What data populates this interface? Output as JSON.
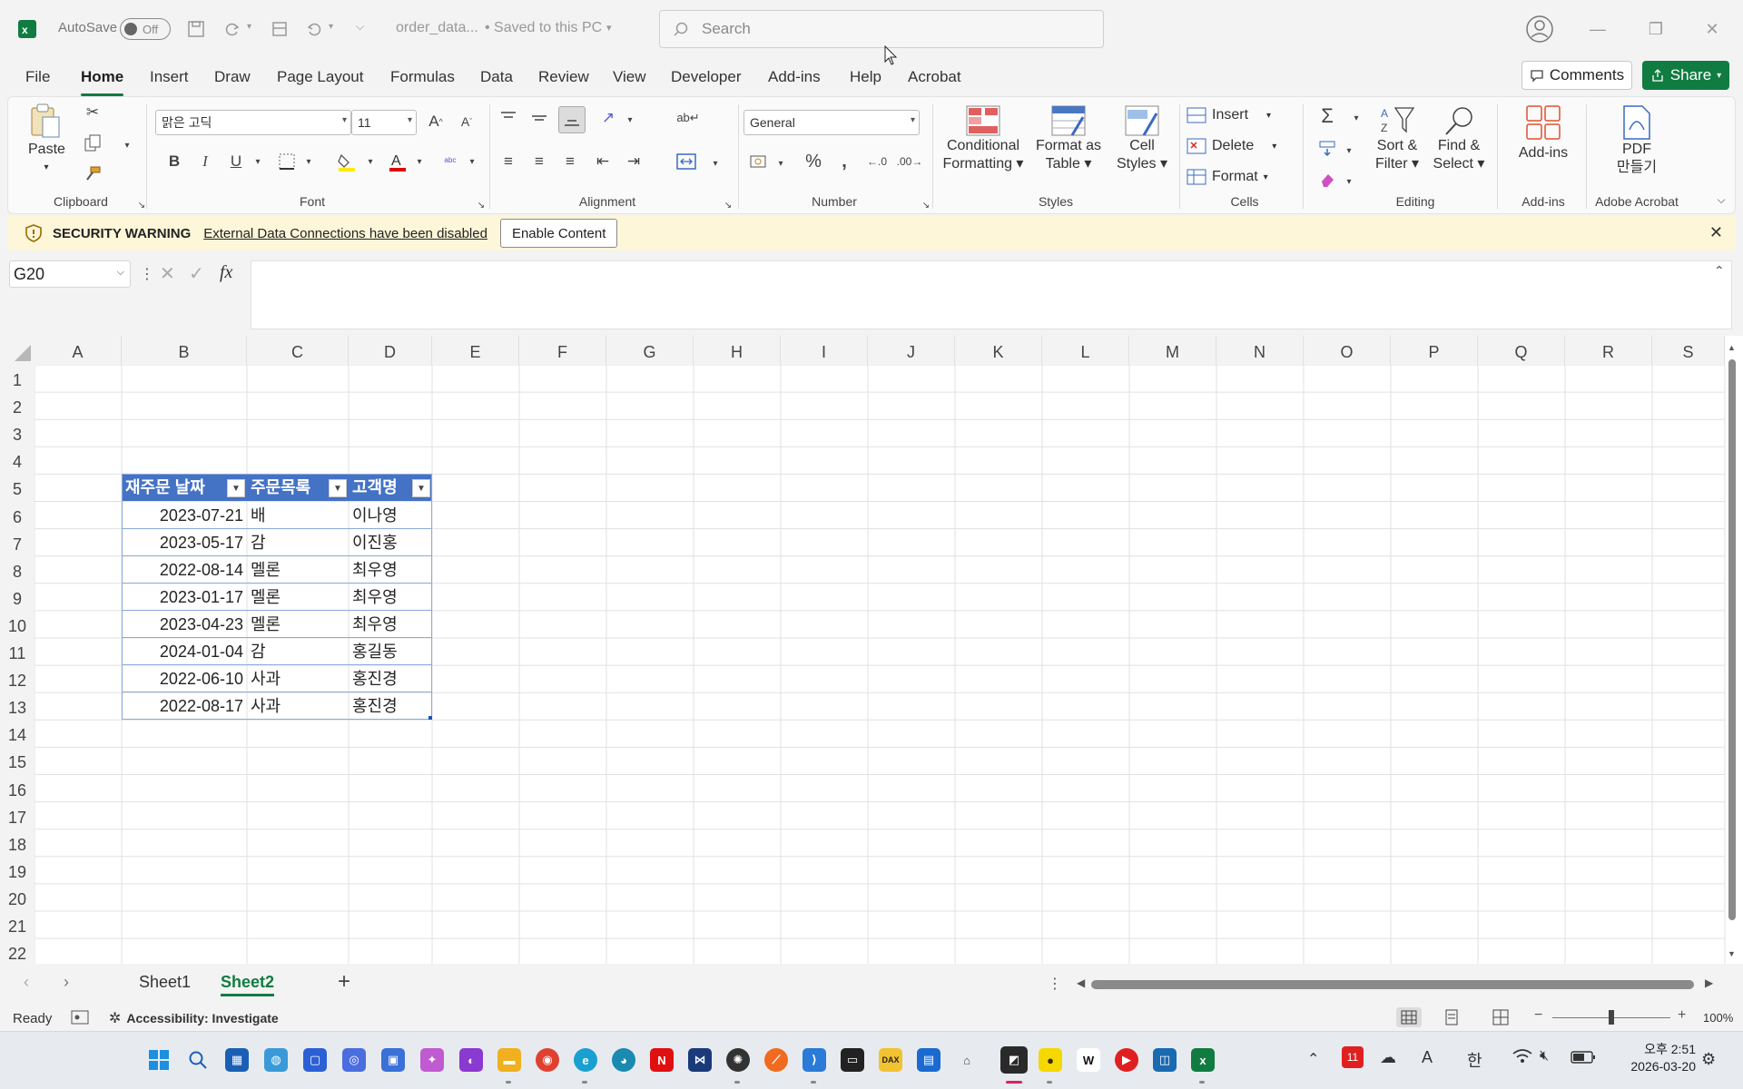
{
  "titlebar": {
    "autosave_label": "AutoSave",
    "autosave_state": "Off",
    "filename": "order_data...",
    "save_status": "• Saved to this PC",
    "search_placeholder": "Search"
  },
  "menu": {
    "tabs": [
      "File",
      "Home",
      "Insert",
      "Draw",
      "Page Layout",
      "Formulas",
      "Data",
      "Review",
      "View",
      "Developer",
      "Add-ins",
      "Help",
      "Acrobat"
    ],
    "active": "Home",
    "comments_label": "Comments",
    "share_label": "Share"
  },
  "ribbon": {
    "clipboard": {
      "label": "Clipboard",
      "paste": "Paste"
    },
    "font": {
      "label": "Font",
      "font_name": "맑은 고딕",
      "font_size": "11"
    },
    "alignment": {
      "label": "Alignment"
    },
    "number": {
      "label": "Number",
      "format": "General"
    },
    "styles": {
      "label": "Styles",
      "conditional_1": "Conditional",
      "conditional_2": "Formatting",
      "format_table_1": "Format as",
      "format_table_2": "Table",
      "cell_styles_1": "Cell",
      "cell_styles_2": "Styles"
    },
    "cells": {
      "label": "Cells",
      "insert": "Insert",
      "delete": "Delete",
      "format": "Format"
    },
    "editing": {
      "label": "Editing",
      "sort_1": "Sort &",
      "sort_2": "Filter",
      "find_1": "Find &",
      "find_2": "Select"
    },
    "addins": {
      "label": "Add-ins",
      "button": "Add-ins"
    },
    "acrobat": {
      "label": "Adobe Acrobat",
      "pdf_1": "PDF",
      "pdf_2": "만들기"
    }
  },
  "warning": {
    "title": "SECURITY WARNING",
    "message": "External Data Connections have been disabled",
    "button": "Enable Content"
  },
  "formula_bar": {
    "name_box": "G20",
    "fx": "fx"
  },
  "grid": {
    "columns": [
      "A",
      "B",
      "C",
      "D",
      "E",
      "F",
      "G",
      "H",
      "I",
      "J",
      "K",
      "L",
      "M",
      "N",
      "O",
      "P",
      "Q",
      "R",
      "S"
    ],
    "rows": [
      "1",
      "2",
      "3",
      "4",
      "5",
      "6",
      "7",
      "8",
      "9",
      "10",
      "11",
      "12",
      "13",
      "14",
      "15",
      "16",
      "17",
      "18",
      "19",
      "20",
      "21",
      "22"
    ],
    "table_headers": [
      "재주문 날짜",
      "주문목록",
      "고객명"
    ],
    "table_rows": [
      [
        "2023-07-21",
        "배",
        "이나영"
      ],
      [
        "2023-05-17",
        "감",
        "이진홍"
      ],
      [
        "2022-08-14",
        "멜론",
        "최우영"
      ],
      [
        "2023-01-17",
        "멜론",
        "최우영"
      ],
      [
        "2023-04-23",
        "멜론",
        "최우영"
      ],
      [
        "2024-01-04",
        "감",
        "홍길동"
      ],
      [
        "2022-06-10",
        "사과",
        "홍진경"
      ],
      [
        "2022-08-17",
        "사과",
        "홍진경"
      ]
    ]
  },
  "sheets": {
    "tabs": [
      "Sheet1",
      "Sheet2"
    ],
    "active": "Sheet2"
  },
  "status": {
    "ready": "Ready",
    "accessibility": "Accessibility: Investigate",
    "zoom": "100%"
  },
  "taskbar": {
    "clock_time": "오후 2:51",
    "clock_date": "2026-03-20",
    "ime": "한",
    "ime_a": "A",
    "colors": {
      "excel": "#107c41",
      "accent": "#0067c0"
    }
  }
}
